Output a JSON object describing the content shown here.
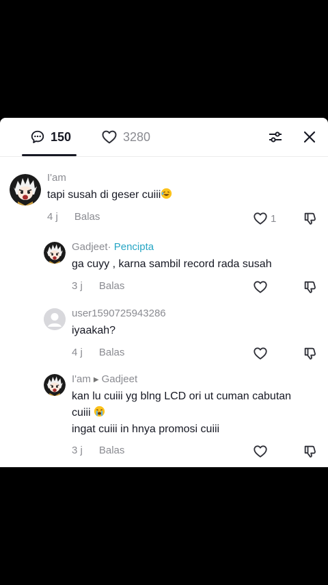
{
  "header": {
    "comments_count": "150",
    "likes_count": "3280"
  },
  "comments": [
    {
      "username": "I'am",
      "text": "tapi susah di geser cuiii",
      "time": "4 j",
      "reply_label": "Balas",
      "like_count": "1",
      "emoji": "laughing-emoji"
    },
    {
      "username": "Gadjeet",
      "separator": "·",
      "creator_label": "Pencipta",
      "text": "ga cuyy , karna sambil record rada susah",
      "time": "3 j",
      "reply_label": "Balas"
    },
    {
      "username": "user1590725943286",
      "text": "iyaakah?",
      "time": "4 j",
      "reply_label": "Balas"
    },
    {
      "username": "I'am",
      "reply_to": "Gadjeet",
      "text_line1": "kan lu cuiii yg blng LCD ori ut cuman cabutan",
      "text_line2": "cuiii",
      "text_line3": "ingat cuiii in hnya promosi cuiii",
      "time": "3 j",
      "reply_label": "Balas",
      "emoji": "crying-emoji"
    }
  ],
  "colors": {
    "background": "#000000",
    "sheet": "#ffffff",
    "primary_text": "#161823",
    "secondary_text": "#8a8b91",
    "creator_accent": "#25a5c4"
  }
}
